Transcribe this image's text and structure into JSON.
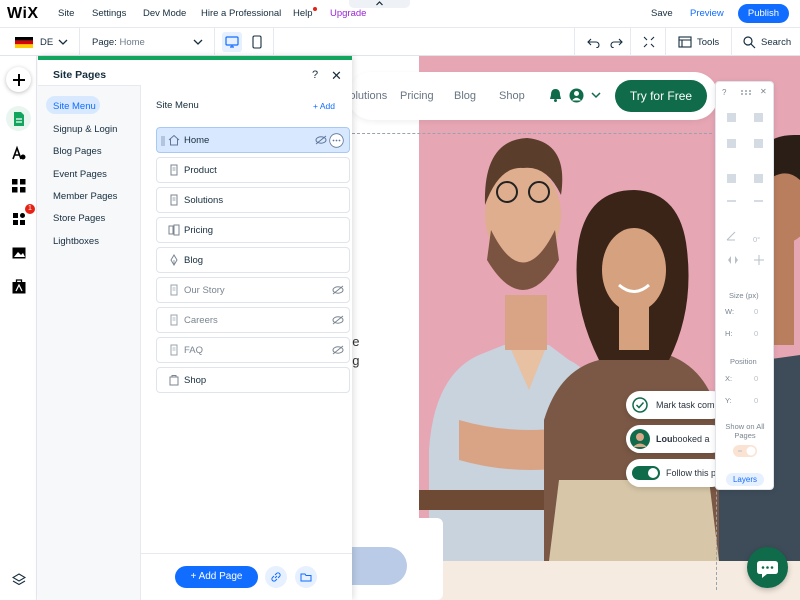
{
  "topbar": {
    "logo": "WiX",
    "menu": [
      "Site",
      "Settings",
      "Dev Mode",
      "Hire a Professional",
      "Help",
      "Upgrade"
    ],
    "save": "Save",
    "preview": "Preview",
    "publish": "Publish"
  },
  "toolbar": {
    "language": "DE",
    "page_label": "Page: ",
    "page_value": "Home",
    "tools": "Tools",
    "search": "Search"
  },
  "rail": {
    "badge": "1"
  },
  "panel": {
    "title": "Site Pages",
    "help": "?",
    "close": "✕",
    "side_items": [
      "Site Menu",
      "Signup & Login",
      "Blog Pages",
      "Event Pages",
      "Member Pages",
      "Store Pages",
      "Lightboxes"
    ],
    "list_title": "Site Menu",
    "add_link": "+ Add",
    "pages": [
      {
        "label": "Home",
        "icon": "home-icon",
        "hidden": false,
        "active": true
      },
      {
        "label": "Product",
        "icon": "page-icon",
        "hidden": false,
        "active": false
      },
      {
        "label": "Solutions",
        "icon": "page-icon",
        "hidden": false,
        "active": false
      },
      {
        "label": "Pricing",
        "icon": "pricing-icon",
        "hidden": false,
        "active": false
      },
      {
        "label": "Blog",
        "icon": "blog-icon",
        "hidden": false,
        "active": false
      },
      {
        "label": "Our Story",
        "icon": "page-icon",
        "hidden": true,
        "active": false
      },
      {
        "label": "Careers",
        "icon": "page-icon",
        "hidden": true,
        "active": false
      },
      {
        "label": "FAQ",
        "icon": "page-icon",
        "hidden": true,
        "active": false
      },
      {
        "label": "Shop",
        "icon": "shop-icon",
        "hidden": false,
        "active": false
      }
    ],
    "add_page": "+ Add Page"
  },
  "site": {
    "nav": [
      "Solutions",
      "Pricing",
      "Blog",
      "Shop"
    ],
    "cta": "Try for Free",
    "hero_lines": [
      ",",
      "ge",
      "ng"
    ],
    "chips": {
      "task": "Mark task com",
      "booked_name": "Lou",
      "booked_text": " booked a",
      "follow": "Follow this p"
    }
  },
  "inspector": {
    "size_label": "Size (px)",
    "w_label": "W:",
    "h_label": "H:",
    "w_value": "0",
    "h_value": "0",
    "position_label": "Position",
    "x_label": "X:",
    "y_label": "Y:",
    "x_value": "0",
    "y_value": "0",
    "angle_value": "0°",
    "show_all_pages": "Show on All Pages",
    "layers": "Layers"
  },
  "colors": {
    "accent_blue": "#116dff",
    "panel_green": "#12a55e",
    "site_green": "#0f6b4a",
    "hero_pink": "#e7a6b4",
    "upgrade_purple": "#9a27d5"
  }
}
